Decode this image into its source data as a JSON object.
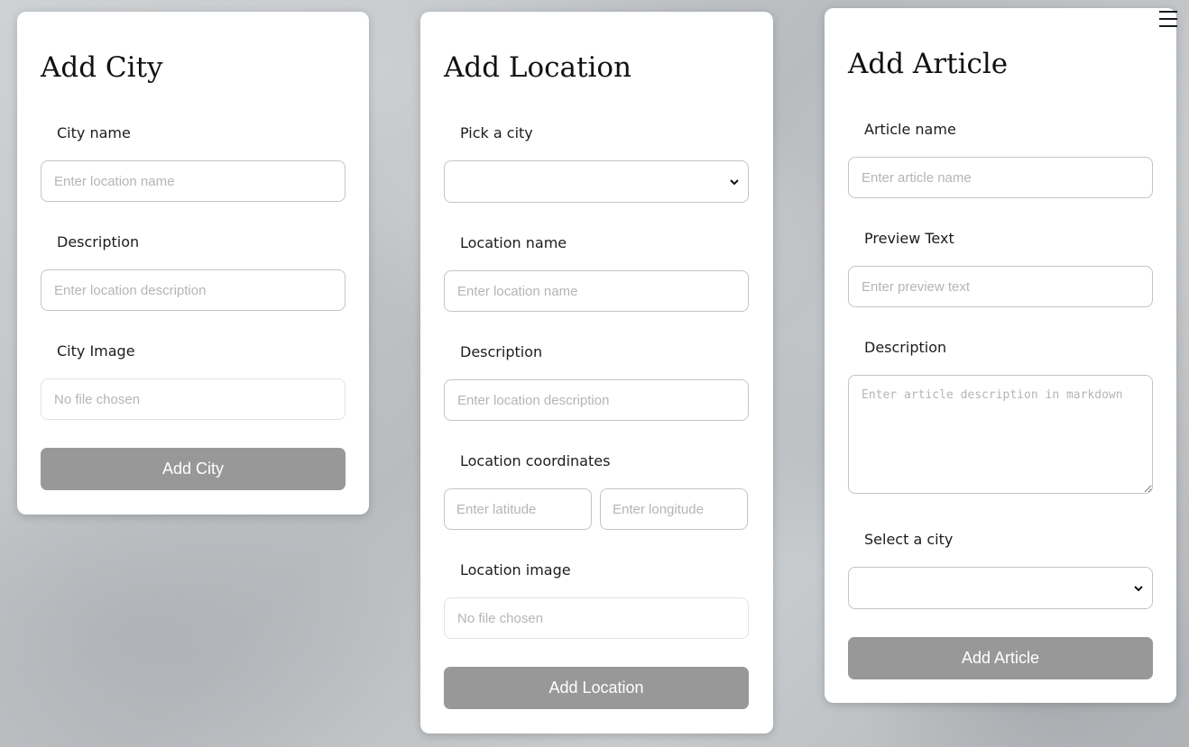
{
  "city_form": {
    "title": "Add City",
    "name_label": "City name",
    "name_placeholder": "Enter location name",
    "description_label": "Description",
    "description_placeholder": "Enter location description",
    "image_label": "City Image",
    "image_file_text": "No file chosen",
    "submit_label": "Add City"
  },
  "location_form": {
    "title": "Add Location",
    "city_label": "Pick a city",
    "city_selected": "",
    "name_label": "Location name",
    "name_placeholder": "Enter location name",
    "description_label": "Description",
    "description_placeholder": "Enter location description",
    "coordinates_label": "Location coordinates",
    "latitude_placeholder": "Enter latitude",
    "longitude_placeholder": "Enter longitude",
    "image_label": "Location image",
    "image_file_text": "No file chosen",
    "submit_label": "Add Location"
  },
  "article_form": {
    "title": "Add Article",
    "name_label": "Article name",
    "name_placeholder": "Enter article name",
    "preview_label": "Preview Text",
    "preview_placeholder": "Enter preview text",
    "description_label": "Description",
    "description_placeholder": "Enter article description in markdown",
    "city_label": "Select a city",
    "city_selected": "",
    "submit_label": "Add Article"
  },
  "nav": {
    "menu_icon": "hamburger-menu-icon"
  },
  "colors": {
    "card_background": "#ffffff",
    "button_background": "#989898",
    "button_text": "#ffffff",
    "input_border": "#c4c4c4"
  }
}
